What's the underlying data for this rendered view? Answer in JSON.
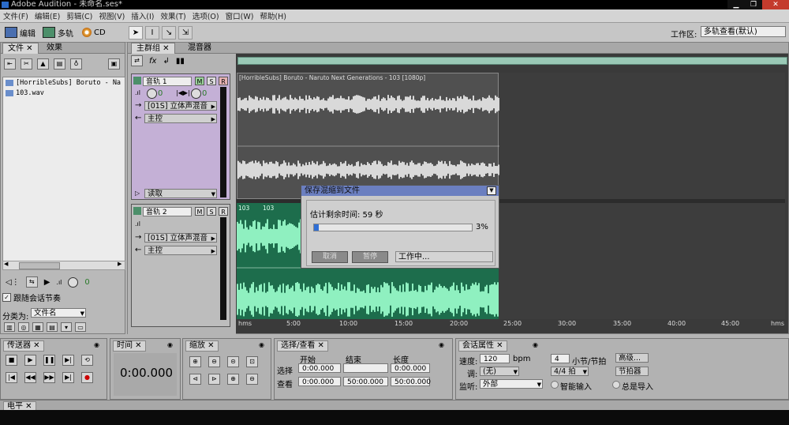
{
  "window": {
    "title": "Adobe Audition - 未命名.ses*"
  },
  "menu": [
    "文件(F)",
    "编辑(E)",
    "剪辑(C)",
    "视图(V)",
    "插入(I)",
    "效果(T)",
    "选项(O)",
    "窗口(W)",
    "帮助(H)"
  ],
  "toolbar": {
    "edit_label": "编辑",
    "multitrack_label": "多轨",
    "cd_label": "CD",
    "workspace_label": "工作区:",
    "workspace_value": "多轨查看(默认)"
  },
  "files_panel": {
    "tab_files": "文件",
    "tab_effects": "效果",
    "items": [
      "[HorribleSubs] Boruto - Na",
      "103.wav"
    ],
    "follow_label": "跟随会话节奏",
    "sort_label": "分类为:",
    "sort_value": "文件名",
    "vol_value": "0"
  },
  "main_panel": {
    "tab_main": "主群组",
    "tab_mixer": "混音器"
  },
  "tracks": [
    {
      "name": "音轨 1",
      "m": "M",
      "s": "S",
      "r": "R",
      "vol": "0",
      "pan": "0",
      "input": "[01S] 立体声混音",
      "output": "主控",
      "automation": "读取"
    },
    {
      "name": "音轨 2",
      "m": "M",
      "s": "S",
      "r": "R",
      "input": "[01S] 立体声混音",
      "output": "主控"
    }
  ],
  "clips": {
    "clip1_title": "[HorribleSubs] Boruto - Naruto Next Generations - 103 [1080p]",
    "clip2_title_a": "103",
    "clip2_title_b": "103"
  },
  "timeline": {
    "labels": [
      "hms",
      "5:00",
      "10:00",
      "15:00",
      "20:00",
      "25:00",
      "30:00",
      "35:00",
      "40:00",
      "45:00",
      "hms"
    ]
  },
  "dialog": {
    "title": "保存混缩到文件",
    "remaining_label": "估计剩余时间: 59 秒",
    "progress": 3,
    "progress_text": "3%",
    "cancel_label": "取消",
    "pause_label": "暂停",
    "status": "工作中..."
  },
  "transport": {
    "tab": "传送器"
  },
  "time_panel": {
    "tab": "时间",
    "value": "0:00.000"
  },
  "zoom_panel": {
    "tab": "缩放"
  },
  "selection": {
    "tab": "选择/查看",
    "col_start": "开始",
    "col_end": "结束",
    "col_length": "长度",
    "row_select": "选择",
    "row_view": "查看",
    "sel_start": "0:00.000",
    "sel_end": "",
    "sel_length": "0:00.000",
    "view_start": "0:00.000",
    "view_end": "50:00.000",
    "view_length": "50:00.000"
  },
  "session": {
    "tab": "会话属性",
    "tempo_label": "速度:",
    "tempo_value": "120",
    "bpm": "bpm",
    "beats_value": "4",
    "beats_label": "小节/节拍",
    "advanced": "高级...",
    "key_label": "调:",
    "key_value": "(无)",
    "meter_value": "4/4 拍",
    "metronome": "节拍器",
    "monitor_label": "监听:",
    "monitor_value": "外部",
    "smart_input": "智能输入",
    "always_input": "总是导入"
  },
  "level": {
    "tab": "电平"
  },
  "colors": {
    "track1_bg": "#c4b0d6",
    "clip2_bg": "#1d6d4c",
    "wave_green": "#8ff0c0",
    "wave_gray": "#d9d9d9",
    "dialog_title": "#6b7fc0",
    "progress": "#2f6fd6"
  }
}
